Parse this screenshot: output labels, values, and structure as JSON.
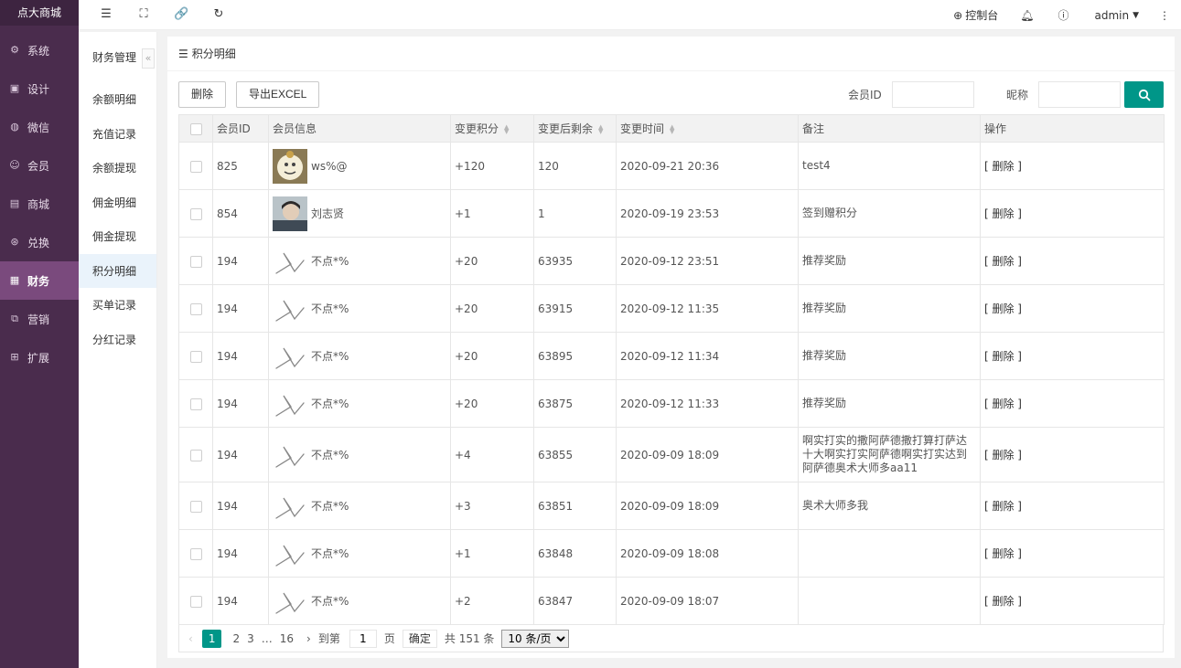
{
  "brand": "点大商城",
  "main_nav": [
    {
      "label": "系统",
      "icon": "gear-icon"
    },
    {
      "label": "设计",
      "icon": "design-icon"
    },
    {
      "label": "微信",
      "icon": "wechat-icon"
    },
    {
      "label": "会员",
      "icon": "user-icon"
    },
    {
      "label": "商城",
      "icon": "shop-icon"
    },
    {
      "label": "兑换",
      "icon": "exchange-icon"
    },
    {
      "label": "财务",
      "icon": "finance-icon",
      "active": true
    },
    {
      "label": "营销",
      "icon": "marketing-icon"
    },
    {
      "label": "扩展",
      "icon": "extend-icon"
    }
  ],
  "sub_nav": {
    "title": "财务管理",
    "items": [
      "余额明细",
      "充值记录",
      "余额提现",
      "佣金明细",
      "佣金提现",
      "积分明细",
      "买单记录",
      "分红记录"
    ],
    "active": "积分明细"
  },
  "header": {
    "console": "控制台",
    "user": "admin"
  },
  "panel": {
    "title": "积分明细"
  },
  "toolbar": {
    "delete": "删除",
    "export": "导出EXCEL",
    "member_id_label": "会员ID",
    "member_id_value": "",
    "nickname_label": "昵称",
    "nickname_value": ""
  },
  "table": {
    "columns": [
      "会员ID",
      "会员信息",
      "变更积分",
      "变更后剩余",
      "变更时间",
      "备注",
      "操作"
    ],
    "rows": [
      {
        "id": "825",
        "name": "ws%@",
        "avatar": "photo",
        "points": "+120",
        "remain": "120",
        "time": "2020-09-21 20:36",
        "remark": "test4",
        "op": "[ 删除 ]"
      },
      {
        "id": "854",
        "name": "刘志贤",
        "avatar": "photo2",
        "points": "+1",
        "remain": "1",
        "time": "2020-09-19 23:53",
        "remark": "签到赠积分",
        "op": "[ 删除 ]"
      },
      {
        "id": "194",
        "name": "不点*%",
        "avatar": "sketch",
        "points": "+20",
        "remain": "63935",
        "time": "2020-09-12 23:51",
        "remark": "推荐奖励",
        "op": "[ 删除 ]"
      },
      {
        "id": "194",
        "name": "不点*%",
        "avatar": "sketch",
        "points": "+20",
        "remain": "63915",
        "time": "2020-09-12 11:35",
        "remark": "推荐奖励",
        "op": "[ 删除 ]"
      },
      {
        "id": "194",
        "name": "不点*%",
        "avatar": "sketch",
        "points": "+20",
        "remain": "63895",
        "time": "2020-09-12 11:34",
        "remark": "推荐奖励",
        "op": "[ 删除 ]"
      },
      {
        "id": "194",
        "name": "不点*%",
        "avatar": "sketch",
        "points": "+20",
        "remain": "63875",
        "time": "2020-09-12 11:33",
        "remark": "推荐奖励",
        "op": "[ 删除 ]"
      },
      {
        "id": "194",
        "name": "不点*%",
        "avatar": "sketch",
        "points": "+4",
        "remain": "63855",
        "time": "2020-09-09 18:09",
        "remark": "啊实打实的撒阿萨德撒打算打萨达十大啊实打实阿萨德啊实打实达到阿萨德奥术大师多aa11",
        "op": "[ 删除 ]",
        "tall": true
      },
      {
        "id": "194",
        "name": "不点*%",
        "avatar": "sketch",
        "points": "+3",
        "remain": "63851",
        "time": "2020-09-09 18:09",
        "remark": "奥术大师多我",
        "op": "[ 删除 ]"
      },
      {
        "id": "194",
        "name": "不点*%",
        "avatar": "sketch",
        "points": "+1",
        "remain": "63848",
        "time": "2020-09-09 18:08",
        "remark": "",
        "op": "[ 删除 ]"
      },
      {
        "id": "194",
        "name": "不点*%",
        "avatar": "sketch",
        "points": "+2",
        "remain": "63847",
        "time": "2020-09-09 18:07",
        "remark": "",
        "op": "[ 删除 ]"
      }
    ]
  },
  "pager": {
    "prev": "‹",
    "pages": [
      "1",
      "2",
      "3",
      "…",
      "16"
    ],
    "next": "›",
    "goto_prefix": "到第",
    "goto_value": "1",
    "goto_suffix": "页",
    "confirm": "确定",
    "total": "共 151 条",
    "page_size": "10 条/页"
  },
  "colors": {
    "sidebar": "#4a2c4d",
    "accent": "#009688",
    "positive": "#2ea12e"
  }
}
